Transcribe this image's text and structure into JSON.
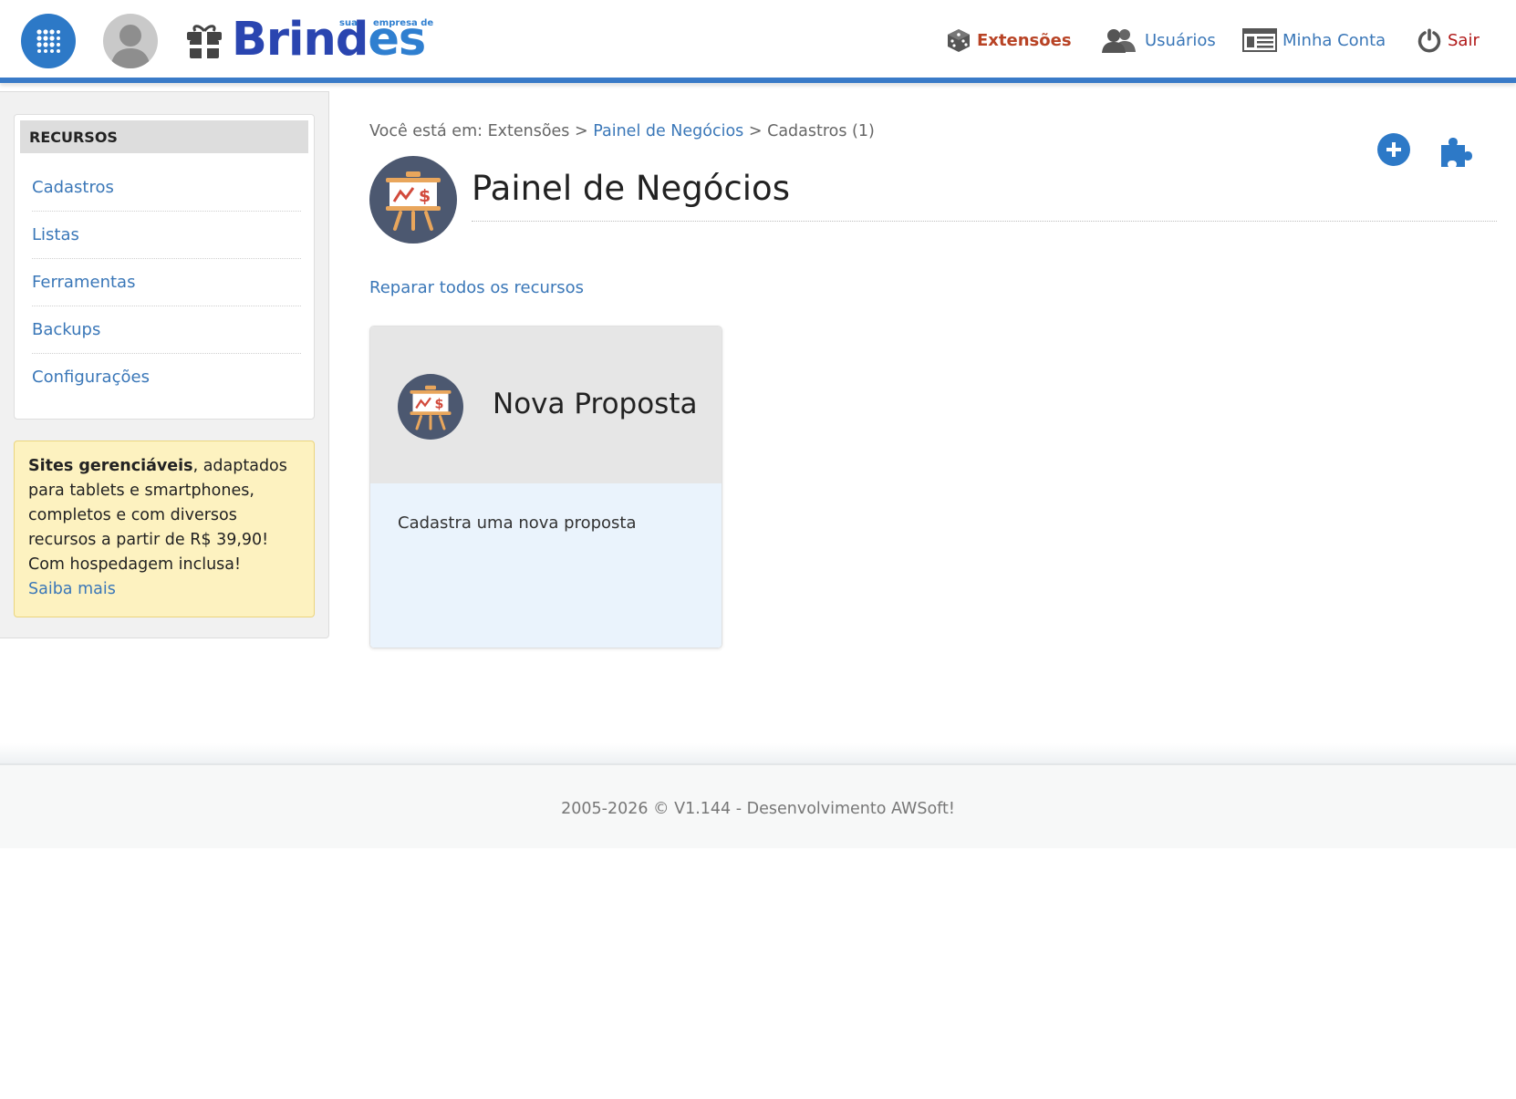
{
  "header": {
    "logo": {
      "word_main": "Brind",
      "word_accent": "es",
      "tag_sua": "sua",
      "tag_empresa": "empresa de"
    },
    "nav": [
      {
        "label": "Extensões",
        "icon": "dice-icon",
        "active": true
      },
      {
        "label": "Usuários",
        "icon": "users-icon"
      },
      {
        "label": "Minha Conta",
        "icon": "account-list-icon"
      },
      {
        "label": "Sair",
        "icon": "power-icon"
      }
    ]
  },
  "sidebar": {
    "title": "RECURSOS",
    "items": [
      {
        "label": "Cadastros"
      },
      {
        "label": "Listas"
      },
      {
        "label": "Ferramentas"
      },
      {
        "label": "Backups"
      },
      {
        "label": "Configurações"
      }
    ],
    "promo": {
      "bold": "Sites gerenciáveis",
      "text": ", adaptados para tablets e smartphones, completos e com diversos recursos a partir de R$ 39,90! Com hospedagem inclusa!",
      "link": "Saiba mais"
    }
  },
  "main": {
    "breadcrumb": {
      "prefix": "Você está em: Extensões >",
      "link": "Painel de Negócios",
      "suffix": "> Cadastros (1)"
    },
    "title": "Painel de Negócios",
    "repair_link": "Reparar todos os recursos",
    "cards": [
      {
        "title": "Nova Proposta",
        "description": "Cadastra uma nova proposta",
        "icon": "easel-chart-icon"
      }
    ]
  },
  "footer": {
    "text": "2005-2026 © V1.144 - Desenvolvimento AWSoft!"
  },
  "colors": {
    "primary_blue": "#2d79c7",
    "link_blue": "#3a77b8",
    "active_nav": "#b84325",
    "logout_red": "#b01818",
    "promo_bg": "#fdf2c0",
    "icon_circle": "#4c5870"
  }
}
